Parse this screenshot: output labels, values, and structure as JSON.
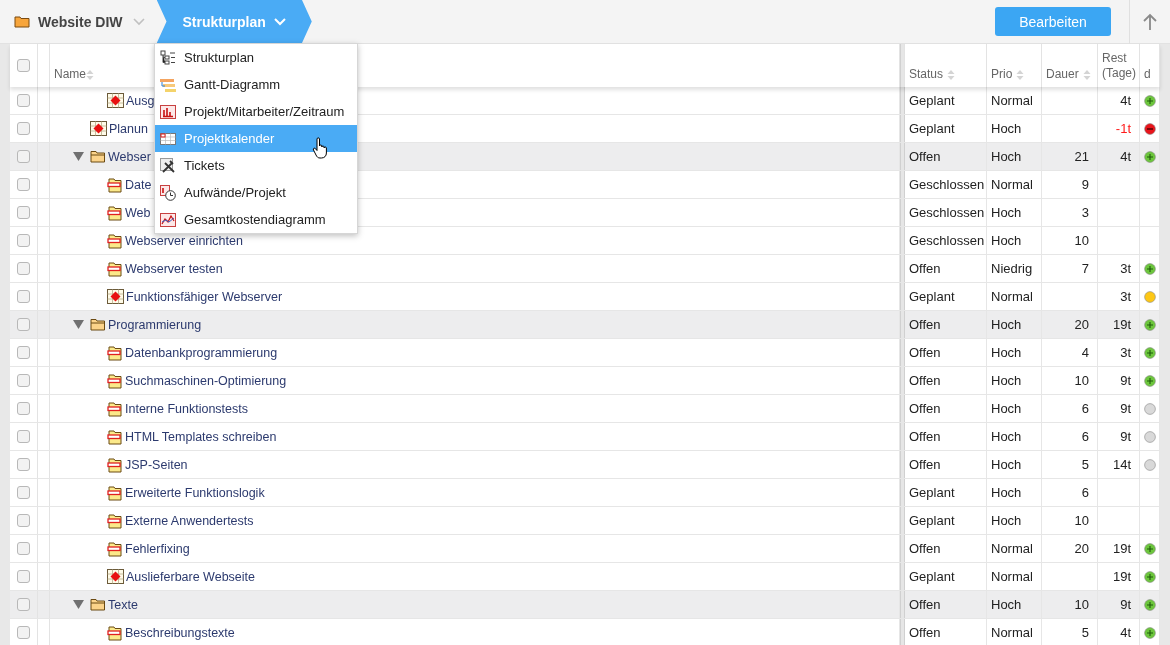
{
  "breadcrumb": [
    {
      "label": "Website DIW",
      "kind": "project",
      "selected": false
    },
    {
      "label": "Strukturplan",
      "kind": "view",
      "selected": true
    }
  ],
  "edit_button": "Bearbeiten",
  "table": {
    "header_checkbox": {
      "checked": false
    },
    "columns": [
      {
        "label": "Name",
        "sortable": true
      },
      {
        "label": "Status",
        "sortable": true
      },
      {
        "label": "Prio",
        "sortable": true
      },
      {
        "label": "Dauer",
        "sortable": true
      },
      {
        "label": "Rest (Tage)"
      },
      {
        "label": "d"
      }
    ],
    "rows": [
      {
        "children": [
          {
            "name": "Ausg",
            "kind": "milestone",
            "checked": false,
            "status": "Geplant",
            "prio": "Normal",
            "rest": "4t",
            "overdue": false,
            "dot": {
              "kind": "plus",
              "color": "#6cc63c"
            }
          }
        ]
      },
      {
        "name": "Planun",
        "kind": "milestone",
        "checked": false,
        "status": "Geplant",
        "prio": "Hoch",
        "rest": "-1t",
        "overdue": true,
        "dot": {
          "kind": "minus",
          "color": "#e8141b"
        }
      },
      {
        "name": "Webser",
        "kind": "group",
        "expanded": true,
        "checked": false,
        "status": "Offen",
        "prio": "Hoch",
        "duration": "21",
        "rest": "4t",
        "overdue": false,
        "dot": {
          "kind": "plus",
          "color": "#6cc63c"
        },
        "children": [
          {
            "name": "Date",
            "kind": "task",
            "checked": false,
            "status": "Geschlossen",
            "prio": "Normal",
            "duration": "9"
          },
          {
            "name": "Web",
            "kind": "task",
            "checked": false,
            "status": "Geschlossen",
            "prio": "Hoch",
            "duration": "3"
          },
          {
            "name": "Webserver einrichten",
            "kind": "task",
            "checked": false,
            "status": "Geschlossen",
            "prio": "Hoch",
            "duration": "10"
          },
          {
            "name": "Webserver testen",
            "kind": "task",
            "checked": false,
            "status": "Offen",
            "prio": "Niedrig",
            "duration": "7",
            "rest": "3t",
            "overdue": false,
            "dot": {
              "kind": "plus",
              "color": "#6cc63c"
            }
          },
          {
            "name": "Funktionsfähiger Webserver",
            "kind": "milestone",
            "checked": false,
            "status": "Geplant",
            "prio": "Normal",
            "rest": "3t",
            "overdue": false,
            "dot": {
              "kind": "plain",
              "color": "#fdc715"
            }
          }
        ]
      },
      {
        "name": "Programmierung",
        "kind": "group",
        "expanded": true,
        "checked": false,
        "status": "Offen",
        "prio": "Hoch",
        "duration": "20",
        "rest": "19t",
        "overdue": false,
        "dot": {
          "kind": "plus",
          "color": "#6cc63c"
        },
        "children": [
          {
            "name": "Datenbankprogrammierung",
            "kind": "task",
            "checked": false,
            "status": "Offen",
            "prio": "Hoch",
            "duration": "4",
            "rest": "3t",
            "overdue": false,
            "dot": {
              "kind": "plus",
              "color": "#6cc63c"
            }
          },
          {
            "name": "Suchmaschinen-Optimierung",
            "kind": "task",
            "checked": false,
            "status": "Offen",
            "prio": "Hoch",
            "duration": "10",
            "rest": "9t",
            "overdue": false,
            "dot": {
              "kind": "plus",
              "color": "#6cc63c"
            }
          },
          {
            "name": "Interne Funktionstests",
            "kind": "task",
            "checked": false,
            "status": "Offen",
            "prio": "Hoch",
            "duration": "6",
            "rest": "9t",
            "overdue": false,
            "dot": {
              "kind": "plain",
              "color": "#d9d9d9"
            }
          },
          {
            "name": "HTML Templates schreiben",
            "kind": "task",
            "checked": false,
            "status": "Offen",
            "prio": "Hoch",
            "duration": "6",
            "rest": "9t",
            "overdue": false,
            "dot": {
              "kind": "plain",
              "color": "#d9d9d9"
            }
          },
          {
            "name": "JSP-Seiten",
            "kind": "task",
            "checked": false,
            "status": "Offen",
            "prio": "Hoch",
            "duration": "5",
            "rest": "14t",
            "overdue": false,
            "dot": {
              "kind": "plain",
              "color": "#d9d9d9"
            }
          },
          {
            "name": "Erweiterte Funktionslogik",
            "kind": "task",
            "checked": false,
            "status": "Geplant",
            "prio": "Hoch",
            "duration": "6"
          },
          {
            "name": "Externe Anwendertests",
            "kind": "task",
            "checked": false,
            "status": "Geplant",
            "prio": "Hoch",
            "duration": "10"
          },
          {
            "name": "Fehlerfixing",
            "kind": "task",
            "checked": false,
            "status": "Offen",
            "prio": "Normal",
            "duration": "20",
            "rest": "19t",
            "overdue": false,
            "dot": {
              "kind": "plus",
              "color": "#6cc63c"
            }
          },
          {
            "name": "Auslieferbare Webseite",
            "kind": "milestone",
            "checked": false,
            "status": "Geplant",
            "prio": "Normal",
            "rest": "19t",
            "overdue": false,
            "dot": {
              "kind": "plus",
              "color": "#6cc63c"
            }
          }
        ]
      },
      {
        "name": "Texte",
        "kind": "group",
        "expanded": true,
        "checked": false,
        "status": "Offen",
        "prio": "Hoch",
        "duration": "10",
        "rest": "9t",
        "overdue": false,
        "dot": {
          "kind": "plus",
          "color": "#6cc63c"
        },
        "children": [
          {
            "name": "Beschreibungstexte",
            "kind": "task",
            "checked": false,
            "status": "Offen",
            "prio": "Normal",
            "duration": "5",
            "rest": "4t",
            "overdue": false,
            "dot": {
              "kind": "plus",
              "color": "#6cc63c"
            }
          }
        ]
      }
    ]
  },
  "view_menu": [
    {
      "label": "Strukturplan",
      "kind": "tree",
      "selected": false
    },
    {
      "label": "Gantt-Diagramm",
      "kind": "gantt",
      "selected": false
    },
    {
      "label": "Projekt/Mitarbeiter/Zeitraum",
      "kind": "bars",
      "selected": false
    },
    {
      "label": "Projektkalender",
      "kind": "calendar",
      "selected": true
    },
    {
      "label": "Tickets",
      "kind": "tools",
      "selected": false
    },
    {
      "label": "Aufwände/Projekt",
      "kind": "clock",
      "selected": false
    },
    {
      "label": "Gesamtkostendiagramm",
      "kind": "line",
      "selected": false
    }
  ]
}
